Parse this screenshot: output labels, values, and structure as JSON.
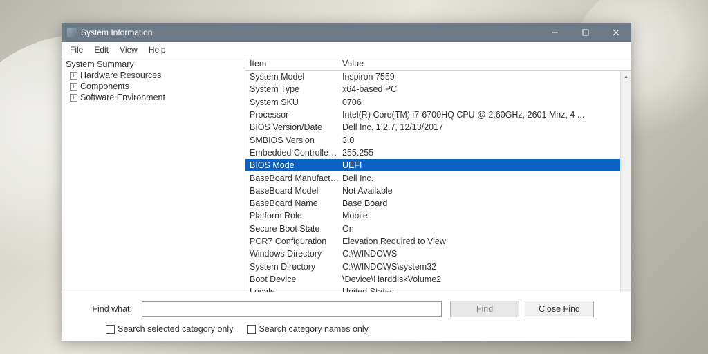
{
  "title": "System Information",
  "menubar": {
    "file": "File",
    "edit": "Edit",
    "view": "View",
    "help": "Help"
  },
  "sidebar": {
    "root": "System Summary",
    "items": [
      {
        "label": "Hardware Resources"
      },
      {
        "label": "Components"
      },
      {
        "label": "Software Environment"
      }
    ]
  },
  "columns": {
    "item": "Item",
    "value": "Value"
  },
  "rows": [
    {
      "item": "System Model",
      "value": "Inspiron 7559"
    },
    {
      "item": "System Type",
      "value": "x64-based PC"
    },
    {
      "item": "System SKU",
      "value": "0706"
    },
    {
      "item": "Processor",
      "value": "Intel(R) Core(TM) i7-6700HQ CPU @ 2.60GHz, 2601 Mhz, 4 ..."
    },
    {
      "item": "BIOS Version/Date",
      "value": "Dell Inc. 1.2.7, 12/13/2017"
    },
    {
      "item": "SMBIOS Version",
      "value": "3.0"
    },
    {
      "item": "Embedded Controller V...",
      "value": "255.255"
    },
    {
      "item": "BIOS Mode",
      "value": "UEFI",
      "selected": true
    },
    {
      "item": "BaseBoard Manufacturer",
      "value": "Dell Inc."
    },
    {
      "item": "BaseBoard Model",
      "value": "Not Available"
    },
    {
      "item": "BaseBoard Name",
      "value": "Base Board"
    },
    {
      "item": "Platform Role",
      "value": "Mobile"
    },
    {
      "item": "Secure Boot State",
      "value": "On"
    },
    {
      "item": "PCR7 Configuration",
      "value": "Elevation Required to View"
    },
    {
      "item": "Windows Directory",
      "value": "C:\\WINDOWS"
    },
    {
      "item": "System Directory",
      "value": "C:\\WINDOWS\\system32"
    },
    {
      "item": "Boot Device",
      "value": "\\Device\\HarddiskVolume2"
    },
    {
      "item": "Locale",
      "value": "United States"
    }
  ],
  "footer": {
    "findLabel": "Find what:",
    "findBtn": "Find",
    "closeFindBtn": "Close Find",
    "check1_pre": "S",
    "check1_rest": "earch selected category only",
    "check2_pre": "Searc",
    "check2_u": "h",
    "check2_rest": " category names only"
  }
}
